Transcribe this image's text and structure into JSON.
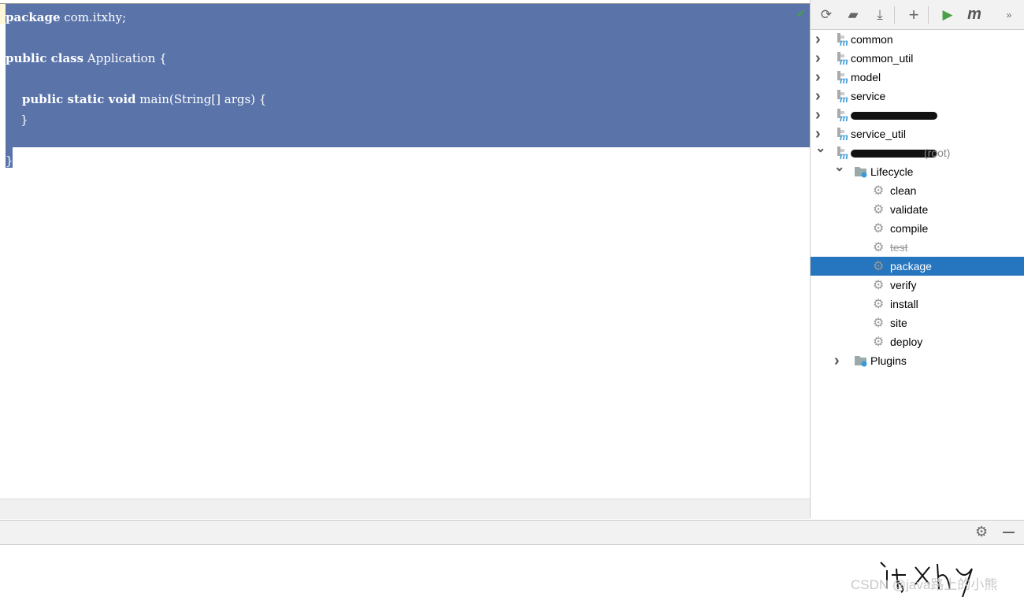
{
  "editor": {
    "lines": [
      {
        "kw": "package",
        "rest": " com.itxhy;"
      },
      {
        "kw": "",
        "rest": ""
      },
      {
        "kw": "public class",
        "rest": " Application {"
      },
      {
        "kw": "",
        "rest": ""
      },
      {
        "kw": "    public static void",
        "rest": " main(String[] args) {"
      },
      {
        "kw": "",
        "rest": "    }"
      },
      {
        "kw": "",
        "rest": ""
      },
      {
        "kw": "",
        "rest": "}"
      }
    ],
    "selection_color": "#5a74aa"
  },
  "maven": {
    "toolbar": [
      "reload-icon",
      "add-folder-icon",
      "download-icon",
      "plus-icon",
      "run-icon",
      "maven-icon",
      "more-icon"
    ],
    "modules": [
      {
        "label": "common",
        "expanded": false
      },
      {
        "label": "common_util",
        "expanded": false
      },
      {
        "label": "model",
        "expanded": false
      },
      {
        "label": "service",
        "expanded": false
      },
      {
        "label": "",
        "expanded": false,
        "redacted": true
      },
      {
        "label": "service_util",
        "expanded": false
      },
      {
        "label": "",
        "suffix": "(root)",
        "expanded": true,
        "redacted": true
      }
    ],
    "lifecycle_label": "Lifecycle",
    "phases": [
      {
        "label": "clean"
      },
      {
        "label": "validate"
      },
      {
        "label": "compile"
      },
      {
        "label": "test",
        "disabled": true
      },
      {
        "label": "package",
        "selected": true
      },
      {
        "label": "verify"
      },
      {
        "label": "install"
      },
      {
        "label": "site"
      },
      {
        "label": "deploy"
      }
    ],
    "plugins_label": "Plugins",
    "selected_color": "#2675bf"
  },
  "watermark": "CSDN @java路上的小熊",
  "handwriting": "itxhy"
}
